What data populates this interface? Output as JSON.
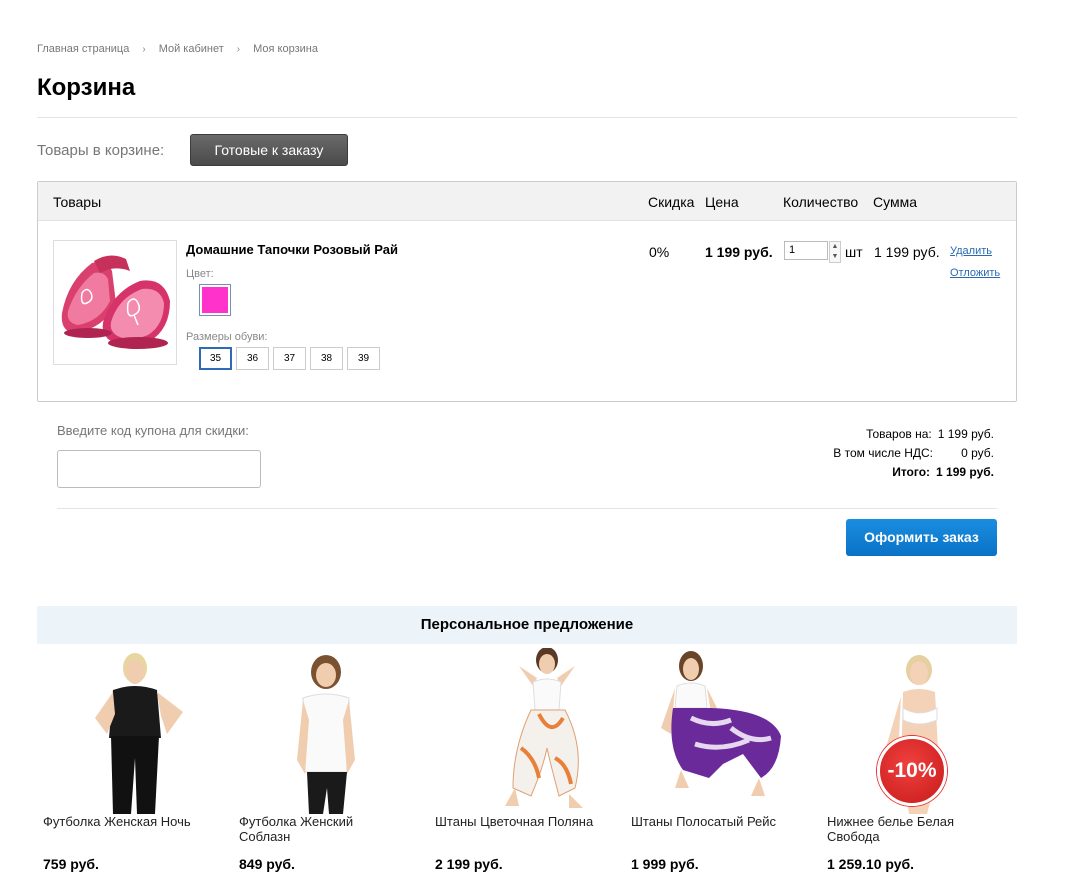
{
  "breadcrumb": {
    "items": [
      "Главная страница",
      "Мой кабинет",
      "Моя корзина"
    ],
    "separator": "›"
  },
  "page_title": "Корзина",
  "filter": {
    "label": "Товары в корзине:",
    "active_button": "Готовые к заказу"
  },
  "cart": {
    "headers": {
      "items": "Товары",
      "discount": "Скидка",
      "price": "Цена",
      "quantity": "Количество",
      "sum": "Сумма"
    },
    "item": {
      "name": "Домашние Тапочки Розовый Рай",
      "color_label": "Цвет:",
      "color_value": "#ff33cc",
      "sizes_label": "Размеры обуви:",
      "sizes": [
        "35",
        "36",
        "37",
        "38",
        "39"
      ],
      "selected_size": "35",
      "discount": "0%",
      "price": "1 199 руб.",
      "quantity": "1",
      "quantity_unit": "шт",
      "sum": "1 199 руб.",
      "delete_label": "Удалить",
      "postpone_label": "Отложить"
    }
  },
  "coupon": {
    "label": "Введите код купона для скидки:",
    "value": ""
  },
  "totals": {
    "goods_label": "Товаров на:",
    "goods_value": "1 199 руб.",
    "vat_label": "В том числе НДС:",
    "vat_value": "0 руб.",
    "total_label": "Итого:",
    "total_value": "1 199 руб."
  },
  "order_button": "Оформить заказ",
  "personal_offer": {
    "title": "Персональное предложение",
    "products": [
      {
        "name": "Футболка Женская Ночь",
        "price": "759 руб."
      },
      {
        "name": "Футболка Женский Соблазн",
        "price": "849 руб."
      },
      {
        "name": "Штаны Цветочная Поляна",
        "price": "2 199 руб."
      },
      {
        "name": "Штаны Полосатый Рейс",
        "price": "1 999 руб."
      },
      {
        "name": "Нижнее белье Белая Свобода",
        "price": "1 259.10 руб.",
        "badge": "-10%"
      }
    ]
  },
  "colors": {
    "accent_blue": "#0a7ed6",
    "link_blue": "#2a6ab2",
    "offer_bar": "#ecf3f9",
    "sale_badge": "#d62020"
  }
}
